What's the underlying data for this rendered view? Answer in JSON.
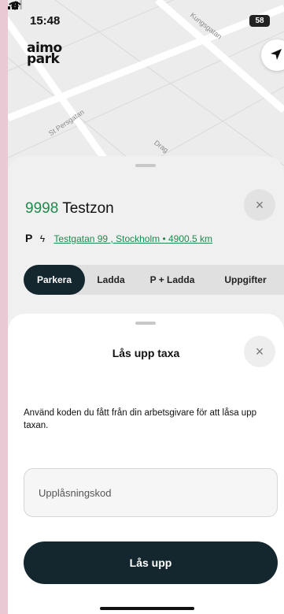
{
  "status_bar": {
    "time": "15:48",
    "battery": "58"
  },
  "map": {
    "streets": [
      "Kungsgatan",
      "St Persgatan",
      "Drag"
    ]
  },
  "logo": {
    "line1": "aimo",
    "line2": "park"
  },
  "zone": {
    "number": "9998",
    "name": "Testzon",
    "p_symbol": "P",
    "bolt_symbol": "ϟ",
    "address": "Testgatan 99 , Stockholm • 4900.5 km"
  },
  "tabs": [
    {
      "label": "Parkera",
      "active": true
    },
    {
      "label": "Ladda",
      "active": false
    },
    {
      "label": "P + Ladda",
      "active": false
    },
    {
      "label": "Uppgifter",
      "active": false
    }
  ],
  "unlock": {
    "title": "Lås upp taxa",
    "description": "Använd koden du fått från din arbetsgivare för att låsa upp taxan.",
    "placeholder": "Upplåsningskod",
    "button": "Lås upp"
  },
  "icons": {
    "close": "×",
    "location_arrow": "location-arrow-icon",
    "signal": "signal-icon",
    "wifi": "wifi-icon"
  },
  "colors": {
    "accent_green": "#1f8a4c",
    "dark": "#15272e"
  }
}
